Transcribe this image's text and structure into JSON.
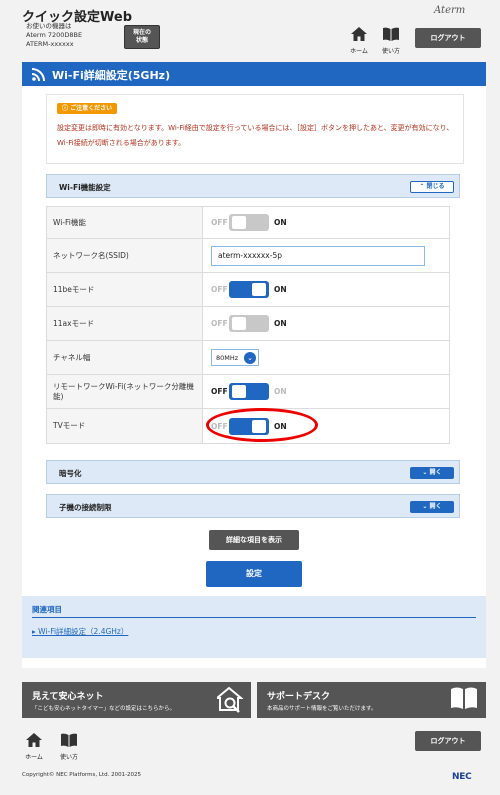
{
  "header": {
    "app_title": "クイック設定Web",
    "device_line1": "お使いの機器は",
    "device_line2": "Aterm 7200D8BE",
    "device_line3": "ATERM-xxxxxx",
    "status_button_line1": "現在の",
    "status_button_line2": "状態",
    "brand": "Aterm",
    "home_label": "ホーム",
    "help_label": "使い方",
    "logout_label": "ログアウト"
  },
  "page": {
    "title": "Wi-Fi詳細設定(5GHz)"
  },
  "notice": {
    "badge": "ご注意ください",
    "text": "設定変更は即時に有効となります。Wi-Fi経由で設定を行っている場合には、［設定］ボタンを押したあと、変更が有効になり、Wi-Fi接続が切断される場合があります。"
  },
  "sections": {
    "wifi_function": {
      "label": "Wi-Fi機能設定",
      "toggle": "閉じる"
    },
    "encryption": {
      "label": "暗号化",
      "toggle": "開く"
    },
    "access_limit": {
      "label": "子機の接続制限",
      "toggle": "開く"
    }
  },
  "settings": {
    "off_label": "OFF",
    "on_label": "ON",
    "wifi_function": {
      "label": "Wi-Fi機能",
      "state": "off"
    },
    "ssid": {
      "label": "ネットワーク名(SSID)",
      "value": "aterm-xxxxxx-5p"
    },
    "mode_11be": {
      "label": "11beモード",
      "state": "on"
    },
    "mode_11ax": {
      "label": "11axモード",
      "state": "off"
    },
    "channel_width": {
      "label": "チャネル幅",
      "value": "80MHz"
    },
    "remote_network": {
      "label": "リモートワークWi-Fi(ネットワーク分離機能)",
      "state": "off"
    },
    "tv_mode": {
      "label": "TVモード",
      "state": "on"
    }
  },
  "buttons": {
    "show_details": "詳細な項目を表示",
    "save": "設定"
  },
  "related": {
    "title": "関連項目",
    "link": "Wi-Fi詳細設定（2.4GHz）"
  },
  "banners": {
    "safety": {
      "title": "見えて安心ネット",
      "subtitle": "「こども安心ネットタイマー」などの設定はこちらから。"
    },
    "support": {
      "title": "サポートデスク",
      "subtitle": "本商品のサポート情報をご覧いただけます。"
    }
  },
  "footer": {
    "home_label": "ホーム",
    "help_label": "使い方",
    "logout_label": "ログアウト",
    "copyright": "Copyright© NEC Platforms, Ltd. 2001-2025",
    "nec": "NEC"
  },
  "colors": {
    "accent": "#1f67c1",
    "notice_text": "#b5301c",
    "highlight_ring": "#e00000"
  }
}
